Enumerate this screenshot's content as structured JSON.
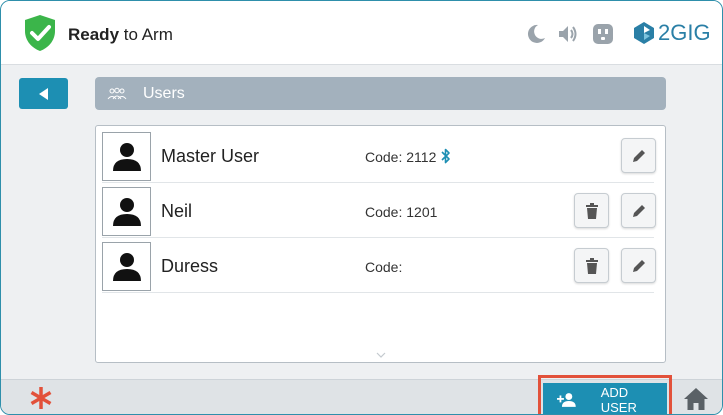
{
  "header": {
    "status_bold": "Ready",
    "status_rest": " to Arm",
    "brand": "2GIG",
    "icons": [
      "shield-check-icon",
      "moon-icon",
      "speaker-icon",
      "outlet-icon",
      "brand-logo-icon"
    ]
  },
  "page": {
    "title": "Users",
    "title_icon": "users-icon",
    "back_icon": "back-arrow-icon"
  },
  "users": [
    {
      "name": "Master User",
      "code": "Code: 2112",
      "bluetooth": true,
      "deletable": false
    },
    {
      "name": "Neil",
      "code": "Code: 1201",
      "bluetooth": false,
      "deletable": true
    },
    {
      "name": "Duress",
      "code": "Code:",
      "bluetooth": false,
      "deletable": true
    }
  ],
  "footer": {
    "add_user_label": "ADD USER",
    "icons": [
      "asterisk-icon",
      "add-user-icon",
      "home-icon"
    ]
  },
  "colors": {
    "accent": "#1d8fb3",
    "status_green": "#3bb54a",
    "alert_red": "#e2513a",
    "title_bar": "#a3b1bd"
  }
}
